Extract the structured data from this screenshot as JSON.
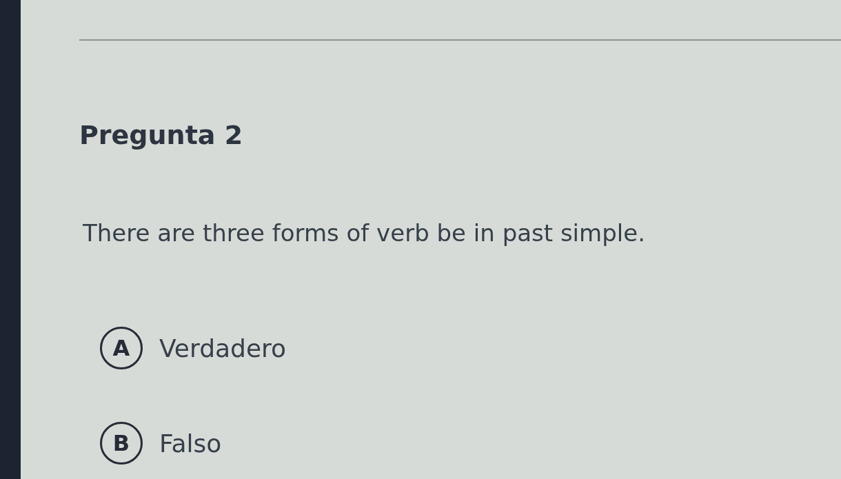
{
  "question": {
    "title": "Pregunta 2",
    "text": "There are three forms of verb be in past simple.",
    "options": [
      {
        "letter": "A",
        "label": "Verdadero",
        "selected": false
      },
      {
        "letter": "B",
        "label": "Falso",
        "selected": false
      }
    ]
  }
}
